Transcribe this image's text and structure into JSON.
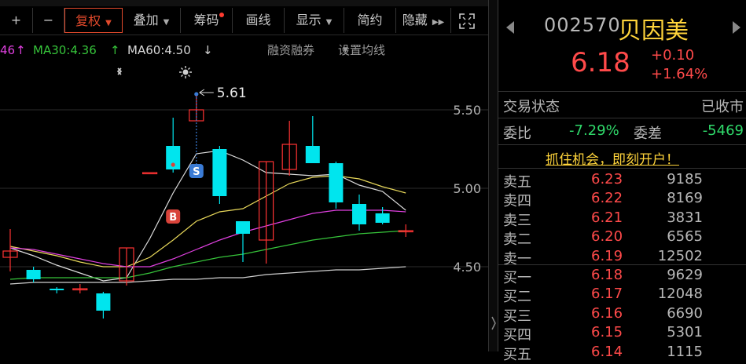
{
  "toolbar": {
    "plus_label": "+",
    "minus_label": "−",
    "fq_label": "复权",
    "overlay_label": "叠加",
    "chips_label": "筹码",
    "draw_label": "画线",
    "display_label": "显示",
    "simple_label": "简约",
    "hide_label": "隐藏"
  },
  "ma": {
    "ma_cut": "46",
    "ma30": "MA30:4.36",
    "ma60": "MA60:4.50",
    "up_arrow": "↑",
    "down_arrow": "↓",
    "margin_label": "融资融券",
    "settings_label": "设置均线"
  },
  "chart_data": {
    "type": "candlestick",
    "y_ticks": [
      "5.50",
      "5.00",
      "4.50"
    ],
    "ylim": [
      4.2,
      5.7
    ],
    "annotation_high": "5.61",
    "buy_marker": "B",
    "sell_marker": "S",
    "candles": [
      {
        "o": 4.56,
        "c": 4.6,
        "h": 4.74,
        "l": 4.47
      },
      {
        "o": 4.48,
        "c": 4.42,
        "h": 4.5,
        "l": 4.4
      },
      {
        "o": 4.36,
        "c": 4.35,
        "h": 4.37,
        "l": 4.33
      },
      {
        "o": 4.36,
        "c": 4.36,
        "h": 4.39,
        "l": 4.33
      },
      {
        "o": 4.33,
        "c": 4.22,
        "h": 4.34,
        "l": 4.17
      },
      {
        "o": 4.41,
        "c": 4.62,
        "h": 4.62,
        "l": 4.38
      },
      {
        "o": 5.1,
        "c": 5.1,
        "h": 5.1,
        "l": 5.1
      },
      {
        "o": 5.27,
        "c": 5.12,
        "h": 5.45,
        "l": 5.1
      },
      {
        "o": 5.43,
        "c": 5.5,
        "h": 5.61,
        "l": 5.43
      },
      {
        "o": 5.25,
        "c": 4.95,
        "h": 5.27,
        "l": 4.9
      },
      {
        "o": 4.79,
        "c": 4.71,
        "h": 4.79,
        "l": 4.53
      },
      {
        "o": 4.67,
        "c": 5.17,
        "h": 5.17,
        "l": 4.52
      },
      {
        "o": 5.12,
        "c": 5.28,
        "h": 5.43,
        "l": 5.08
      },
      {
        "o": 5.27,
        "c": 5.16,
        "h": 5.46,
        "l": 5.16
      },
      {
        "o": 5.16,
        "c": 4.91,
        "h": 5.17,
        "l": 4.87
      },
      {
        "o": 4.9,
        "c": 4.77,
        "h": 4.96,
        "l": 4.73
      },
      {
        "o": 4.84,
        "c": 4.78,
        "h": 4.88,
        "l": 4.77
      },
      {
        "o": 4.73,
        "c": 4.73,
        "h": 4.77,
        "l": 4.69
      }
    ],
    "lines": [
      {
        "color": "#dddddd",
        "values": [
          4.62,
          4.57,
          4.51,
          4.46,
          4.41,
          4.43,
          4.68,
          4.97,
          5.22,
          5.24,
          5.18,
          5.1,
          5.09,
          5.08,
          5.09,
          5.02,
          4.98,
          4.86
        ]
      },
      {
        "color": "#e8d85a",
        "values": [
          4.63,
          4.6,
          4.57,
          4.53,
          4.5,
          4.5,
          4.56,
          4.67,
          4.79,
          4.85,
          4.87,
          4.95,
          5.03,
          5.07,
          5.08,
          5.06,
          5.01,
          4.97
        ]
      },
      {
        "color": "#e040e0",
        "values": [
          4.62,
          4.61,
          4.58,
          4.55,
          4.52,
          4.5,
          4.5,
          4.55,
          4.61,
          4.67,
          4.72,
          4.76,
          4.8,
          4.84,
          4.86,
          4.86,
          4.86,
          4.85
        ]
      },
      {
        "color": "#36c43a",
        "values": [
          4.42,
          4.43,
          4.43,
          4.43,
          4.43,
          4.43,
          4.46,
          4.5,
          4.53,
          4.56,
          4.58,
          4.61,
          4.64,
          4.67,
          4.69,
          4.71,
          4.72,
          4.73
        ]
      },
      {
        "color": "#cfcfcf",
        "values": [
          4.39,
          4.4,
          4.4,
          4.4,
          4.4,
          4.4,
          4.41,
          4.42,
          4.42,
          4.43,
          4.43,
          4.45,
          4.46,
          4.47,
          4.48,
          4.48,
          4.49,
          4.5
        ]
      }
    ]
  },
  "quote": {
    "code": "002570",
    "name": "贝因美",
    "price": "6.18",
    "change": "+0.10",
    "change_pct": "+1.64%",
    "status_label": "交易状态",
    "status_value": "已收市",
    "weibi_label": "委比",
    "weibi_value": "-7.29%",
    "weicha_label": "委差",
    "weicha_value": "-5469",
    "promo": "抓住机会，即刻开户！"
  },
  "order_book": {
    "asks": [
      {
        "label": "卖五",
        "price": "6.23",
        "vol": "9185"
      },
      {
        "label": "卖四",
        "price": "6.22",
        "vol": "8169"
      },
      {
        "label": "卖三",
        "price": "6.21",
        "vol": "3831"
      },
      {
        "label": "卖二",
        "price": "6.20",
        "vol": "6565"
      },
      {
        "label": "卖一",
        "price": "6.19",
        "vol": "12502"
      }
    ],
    "bids": [
      {
        "label": "买一",
        "price": "6.18",
        "vol": "9629"
      },
      {
        "label": "买二",
        "price": "6.17",
        "vol": "12048"
      },
      {
        "label": "买三",
        "price": "6.16",
        "vol": "6690"
      },
      {
        "label": "买四",
        "price": "6.15",
        "vol": "5301"
      },
      {
        "label": "买五",
        "price": "6.14",
        "vol": "1115"
      }
    ]
  },
  "colors": {
    "up": "#ff3333",
    "down": "#00e5ee",
    "accent": "#e34a2c"
  }
}
